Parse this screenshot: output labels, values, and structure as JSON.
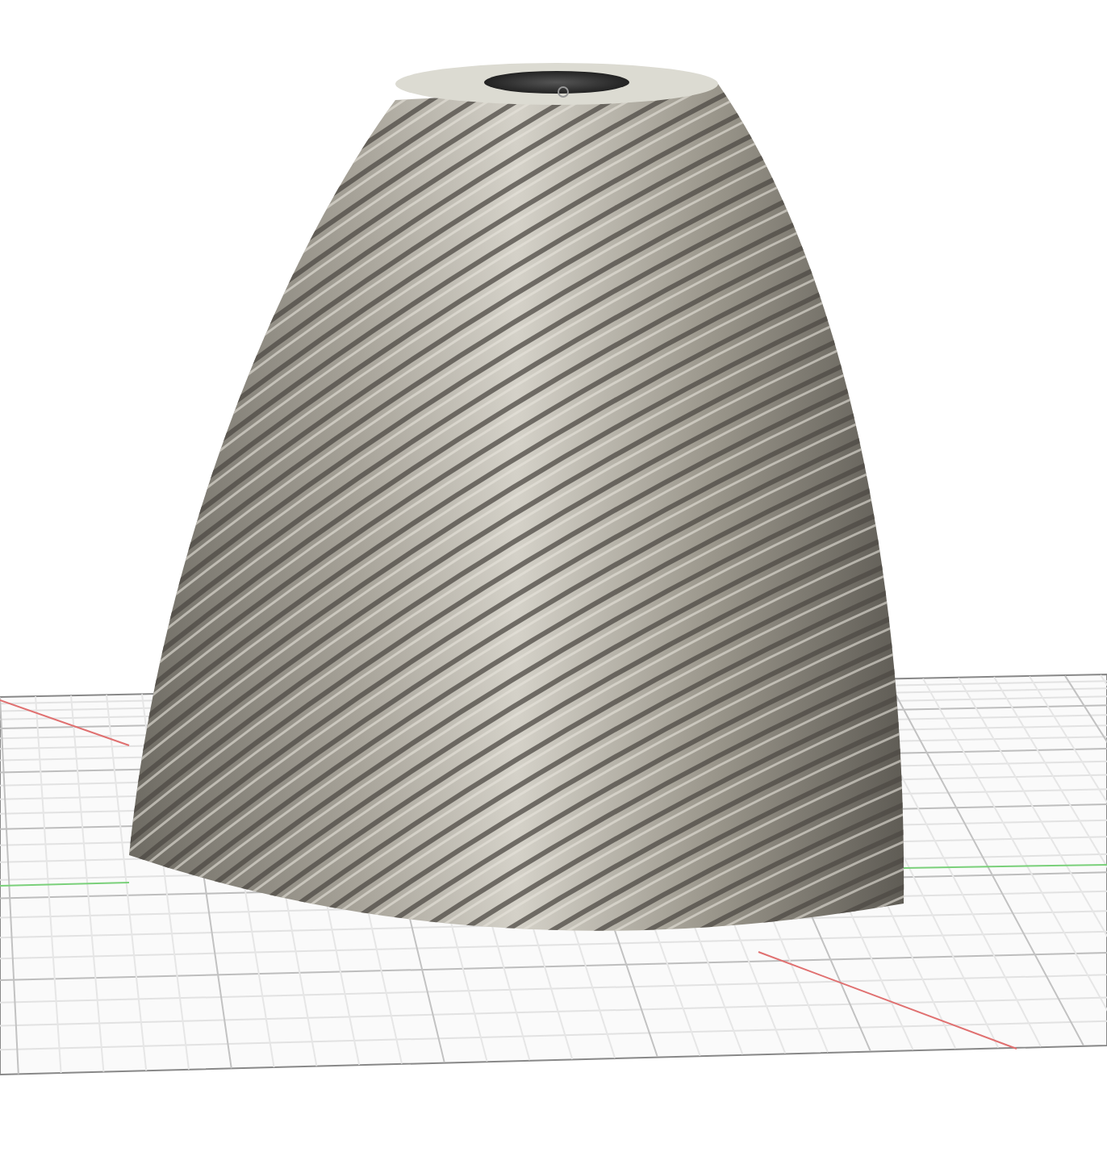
{
  "viewport": {
    "grid": {
      "on": true
    }
  }
}
